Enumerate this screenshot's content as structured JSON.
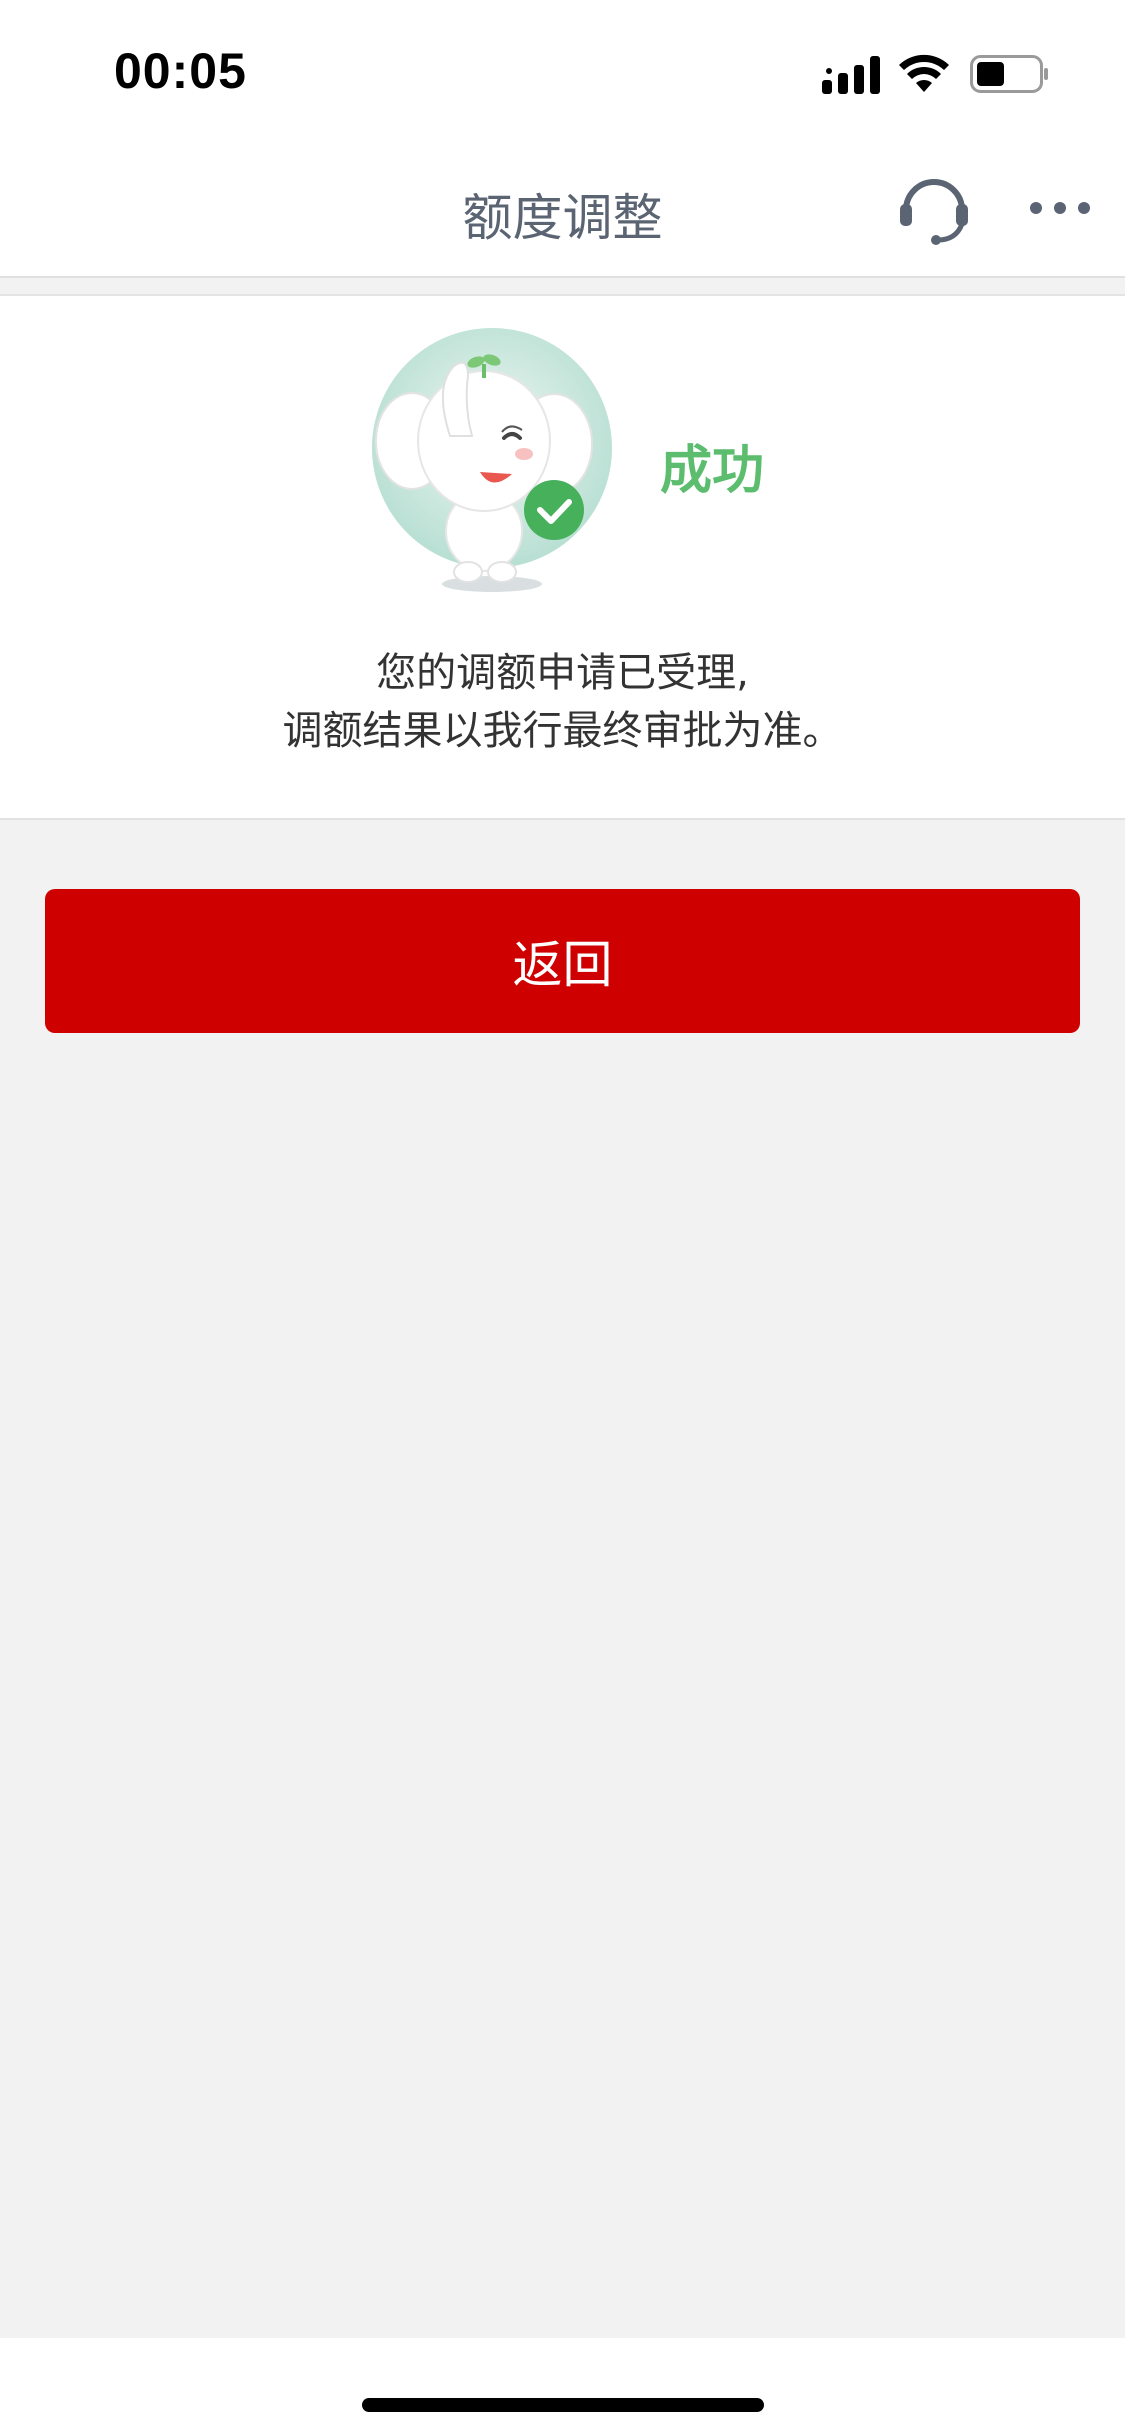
{
  "status_bar": {
    "time": "00:05",
    "icons": [
      "signal-icon",
      "wifi-icon",
      "battery-icon"
    ],
    "battery_level_percent": 45
  },
  "nav": {
    "title": "额度调整",
    "icons": [
      "headset-icon",
      "more-icon"
    ]
  },
  "result": {
    "status": "成功",
    "message_line1": "您的调额申请已受理,",
    "message_line2": "调额结果以我行最终审批为准。",
    "mascot": "elephant-success-mascot"
  },
  "actions": {
    "return_label": "返回"
  },
  "colors": {
    "success_green": "#5cbd6e",
    "primary_red": "#cf0000",
    "title_gray": "#5b6472",
    "background": "#f2f2f2"
  }
}
